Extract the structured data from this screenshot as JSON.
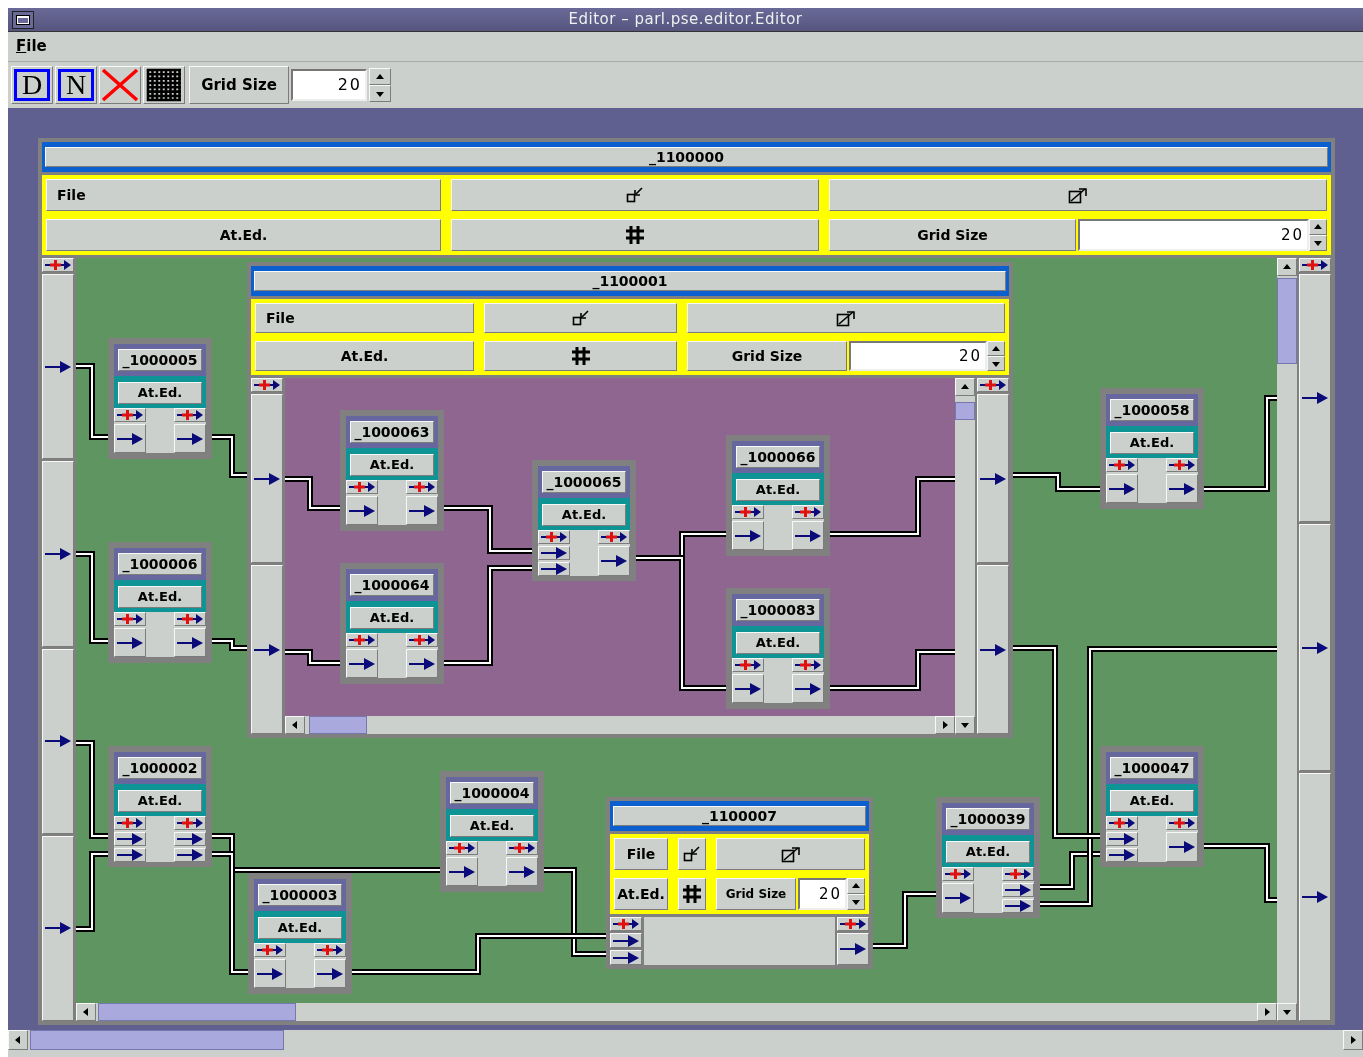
{
  "window": {
    "title": "Editor – parl.pse.editor.Editor"
  },
  "menu": [
    {
      "label": "File"
    }
  ],
  "toolbar": {
    "tools": [
      {
        "kind": "letter",
        "label": "D"
      },
      {
        "kind": "letter",
        "label": "N"
      },
      {
        "kind": "delete"
      },
      {
        "kind": "grid"
      }
    ],
    "grid_size_label": "Grid Size",
    "grid_size": "20"
  },
  "editor": {
    "kind": "composite",
    "title": "_1100000",
    "file_label": "File",
    "attr_label": "At.Ed.",
    "grid_size_label": "Grid Size",
    "grid_size": "20",
    "expanded": true,
    "left_ports": [
      {
        "kind": "add"
      },
      {
        "kind": "arrow"
      },
      {
        "kind": "arrow"
      },
      {
        "kind": "arrow"
      },
      {
        "kind": "arrow"
      }
    ],
    "right_ports": [
      {
        "kind": "add"
      },
      {
        "kind": "arrow"
      },
      {
        "kind": "arrow"
      },
      {
        "kind": "arrow"
      }
    ],
    "items": [
      {
        "kind": "composite",
        "title": "_1100001",
        "file_label": "File",
        "attr_label": "At.Ed.",
        "grid_size_label": "Grid Size",
        "grid_size": "20",
        "expanded": true,
        "left_ports": [
          {
            "kind": "add"
          },
          {
            "kind": "arrow"
          },
          {
            "kind": "arrow"
          }
        ],
        "right_ports": [
          {
            "kind": "add"
          },
          {
            "kind": "arrow"
          },
          {
            "kind": "arrow"
          }
        ],
        "items": [
          {
            "kind": "node",
            "title": "_1000063",
            "attr_label": "At.Ed.",
            "left_ports": [
              {
                "kind": "add"
              },
              {
                "kind": "arrow"
              }
            ],
            "right_ports": [
              {
                "kind": "add"
              },
              {
                "kind": "arrow"
              }
            ]
          },
          {
            "kind": "node",
            "title": "_1000066",
            "attr_label": "At.Ed.",
            "left_ports": [
              {
                "kind": "add"
              },
              {
                "kind": "arrow"
              }
            ],
            "right_ports": [
              {
                "kind": "add"
              },
              {
                "kind": "arrow"
              }
            ]
          },
          {
            "kind": "node",
            "title": "_1000065",
            "attr_label": "At.Ed.",
            "left_ports": [
              {
                "kind": "add"
              },
              {
                "kind": "arrow"
              },
              {
                "kind": "arrow"
              }
            ],
            "right_ports": [
              {
                "kind": "add"
              },
              {
                "kind": "arrow"
              }
            ]
          },
          {
            "kind": "node",
            "title": "_1000064",
            "attr_label": "At.Ed.",
            "left_ports": [
              {
                "kind": "add"
              },
              {
                "kind": "arrow"
              }
            ],
            "right_ports": [
              {
                "kind": "add"
              },
              {
                "kind": "arrow"
              }
            ]
          },
          {
            "kind": "node",
            "title": "_1000083",
            "attr_label": "At.Ed.",
            "left_ports": [
              {
                "kind": "add"
              },
              {
                "kind": "arrow"
              }
            ],
            "right_ports": [
              {
                "kind": "add"
              },
              {
                "kind": "arrow"
              }
            ]
          }
        ]
      },
      {
        "kind": "node",
        "title": "_1000005",
        "attr_label": "At.Ed.",
        "left_ports": [
          {
            "kind": "add"
          },
          {
            "kind": "arrow"
          }
        ],
        "right_ports": [
          {
            "kind": "add"
          },
          {
            "kind": "arrow"
          }
        ]
      },
      {
        "kind": "node",
        "title": "_1000058",
        "attr_label": "At.Ed.",
        "left_ports": [
          {
            "kind": "add"
          },
          {
            "kind": "arrow"
          }
        ],
        "right_ports": [
          {
            "kind": "add"
          },
          {
            "kind": "arrow"
          }
        ]
      },
      {
        "kind": "node",
        "title": "_1000006",
        "attr_label": "At.Ed.",
        "left_ports": [
          {
            "kind": "add"
          },
          {
            "kind": "arrow"
          }
        ],
        "right_ports": [
          {
            "kind": "add"
          },
          {
            "kind": "arrow"
          }
        ]
      },
      {
        "kind": "node",
        "title": "_1000002",
        "attr_label": "At.Ed.",
        "left_ports": [
          {
            "kind": "add"
          },
          {
            "kind": "arrow"
          },
          {
            "kind": "arrow"
          }
        ],
        "right_ports": [
          {
            "kind": "add"
          },
          {
            "kind": "arrow"
          },
          {
            "kind": "arrow"
          }
        ]
      },
      {
        "kind": "node",
        "title": "_1000047",
        "attr_label": "At.Ed.",
        "left_ports": [
          {
            "kind": "add"
          },
          {
            "kind": "arrow"
          },
          {
            "kind": "arrow"
          }
        ],
        "right_ports": [
          {
            "kind": "add"
          },
          {
            "kind": "arrow"
          }
        ]
      },
      {
        "kind": "node",
        "title": "_1000004",
        "attr_label": "At.Ed.",
        "left_ports": [
          {
            "kind": "add"
          },
          {
            "kind": "arrow"
          }
        ],
        "right_ports": [
          {
            "kind": "add"
          },
          {
            "kind": "arrow"
          }
        ]
      },
      {
        "kind": "composite",
        "title": "_1100007",
        "file_label": "File",
        "attr_label": "At.Ed.",
        "grid_size_label": "Grid Size",
        "grid_size": "20",
        "expanded": false,
        "left_ports": [
          {
            "kind": "add"
          },
          {
            "kind": "arrow"
          },
          {
            "kind": "arrow"
          }
        ],
        "right_ports": [
          {
            "kind": "add"
          },
          {
            "kind": "arrow"
          }
        ]
      },
      {
        "kind": "node",
        "title": "_1000039",
        "attr_label": "At.Ed.",
        "left_ports": [
          {
            "kind": "add"
          },
          {
            "kind": "arrow"
          }
        ],
        "right_ports": [
          {
            "kind": "add"
          },
          {
            "kind": "arrow"
          },
          {
            "kind": "arrow"
          }
        ]
      },
      {
        "kind": "node",
        "title": "_1000003",
        "attr_label": "At.Ed.",
        "left_ports": [
          {
            "kind": "add"
          },
          {
            "kind": "arrow"
          }
        ],
        "right_ports": [
          {
            "kind": "add"
          },
          {
            "kind": "arrow"
          }
        ]
      }
    ]
  }
}
